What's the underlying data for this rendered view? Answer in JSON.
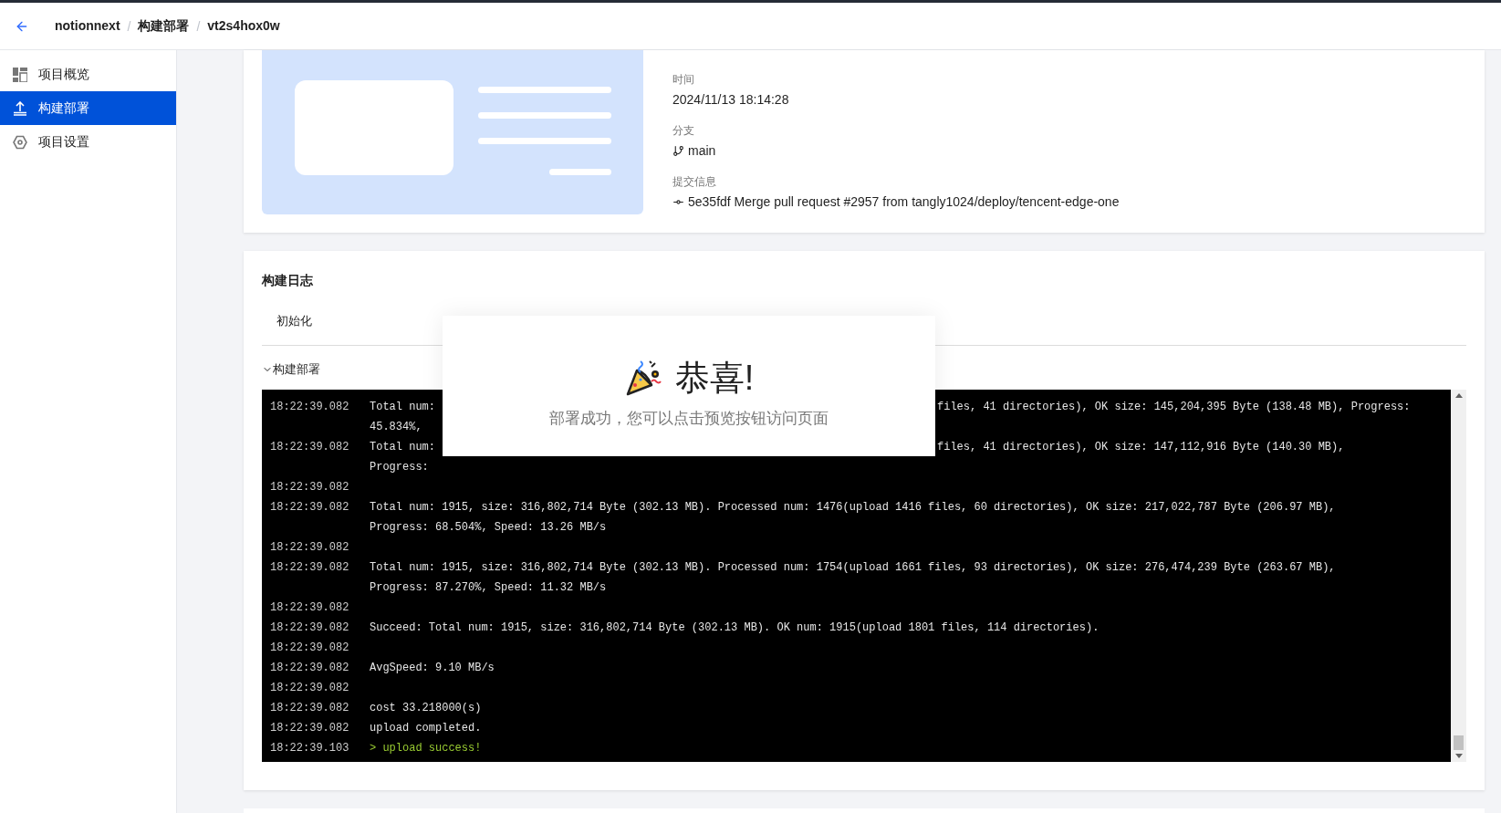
{
  "header": {
    "breadcrumb": [
      "notionnext",
      "构建部署",
      "vt2s4hox0w"
    ],
    "separator": "/"
  },
  "sidebar": {
    "items": [
      {
        "label": "项目概览",
        "kind": "overview",
        "selected": false
      },
      {
        "label": "构建部署",
        "kind": "upload",
        "selected": true
      },
      {
        "label": "项目设置",
        "kind": "settings",
        "selected": false
      }
    ]
  },
  "deployment": {
    "fields": [
      {
        "label": "时间",
        "value": "2024/11/13 18:14:28",
        "kind": "text"
      },
      {
        "label": "分支",
        "value": "main",
        "kind": "branch"
      },
      {
        "label": "提交信息",
        "value": "5e35fdf Merge pull request #2957 from tangly1024/deploy/tencent-edge-one",
        "kind": "commit"
      }
    ]
  },
  "build_log": {
    "title": "构建日志",
    "tabs": [
      {
        "label": "初始化"
      }
    ],
    "section": {
      "label": "构建部署",
      "expanded": true
    },
    "entries": [
      {
        "time": "18:22:39.082",
        "kind": "covered",
        "segments": [
          {
            "before": "Total num:",
            "after": "files, 41 directories), OK size: 145,204,395 Byte (138.48 MB), Progress:"
          },
          {
            "before": "45.834%,"
          }
        ]
      },
      {
        "time": "18:22:39.082",
        "kind": "covered",
        "segments": [
          {
            "before": "Total num:",
            "after": "files, 41 directories), OK size: 147,112,916 Byte (140.30 MB),"
          },
          {
            "before": "Progress:"
          }
        ]
      },
      {
        "time": "18:22:39.082",
        "kind": "plain"
      },
      {
        "time": "18:22:39.082",
        "kind": "plain",
        "lines": [
          "Total num: 1915, size: 316,802,714 Byte (302.13 MB). Processed num: 1476(upload 1416 files, 60 directories), OK size: 217,022,787 Byte (206.97 MB),",
          "Progress: 68.504%, Speed: 13.26 MB/s"
        ]
      },
      {
        "time": "18:22:39.082",
        "kind": "plain"
      },
      {
        "time": "18:22:39.082",
        "kind": "plain",
        "lines": [
          "Total num: 1915, size: 316,802,714 Byte (302.13 MB). Processed num: 1754(upload 1661 files, 93 directories), OK size: 276,474,239 Byte (263.67 MB),",
          "Progress: 87.270%, Speed: 11.32 MB/s"
        ]
      },
      {
        "time": "18:22:39.082",
        "kind": "plain"
      },
      {
        "time": "18:22:39.082",
        "kind": "plain",
        "lines": [
          "Succeed: Total num: 1915, size: 316,802,714 Byte (302.13 MB). OK num: 1915(upload 1801 files, 114 directories)."
        ]
      },
      {
        "time": "18:22:39.082",
        "kind": "plain"
      },
      {
        "time": "18:22:39.082",
        "kind": "plain",
        "lines": [
          "AvgSpeed: 9.10 MB/s"
        ]
      },
      {
        "time": "18:22:39.082",
        "kind": "plain"
      },
      {
        "time": "18:22:39.082",
        "kind": "plain",
        "lines": [
          "cost 33.218000(s)"
        ]
      },
      {
        "time": "18:22:39.082",
        "kind": "plain",
        "lines": [
          "upload completed."
        ]
      },
      {
        "time": "18:22:39.103",
        "kind": "success",
        "lines": [
          "> upload success!"
        ]
      }
    ]
  },
  "dialog": {
    "title": "恭喜!",
    "message": "部署成功，您可以点击预览按钮访问页面"
  }
}
